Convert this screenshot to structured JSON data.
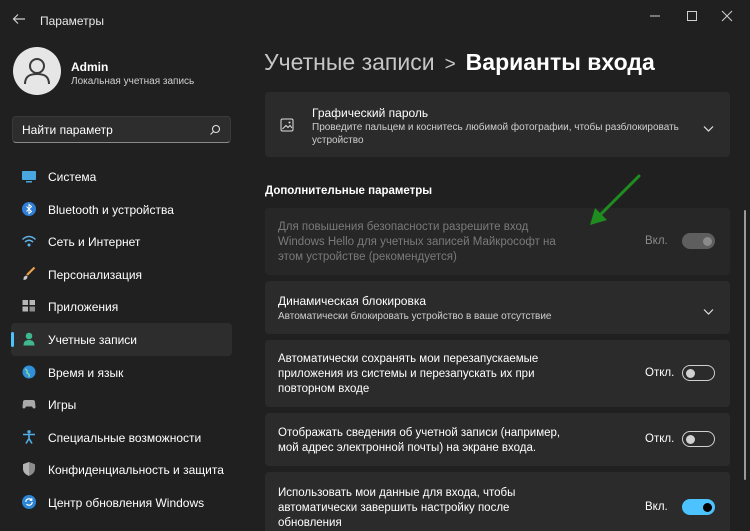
{
  "window": {
    "title": "Параметры"
  },
  "user": {
    "name": "Admin",
    "account_type": "Локальная учетная запись"
  },
  "search": {
    "placeholder": "Найти параметр"
  },
  "sidebar": {
    "items": [
      {
        "label": "Система",
        "icon": "system-icon"
      },
      {
        "label": "Bluetooth и устройства",
        "icon": "bluetooth-icon"
      },
      {
        "label": "Сеть и Интернет",
        "icon": "wifi-icon"
      },
      {
        "label": "Персонализация",
        "icon": "brush-icon"
      },
      {
        "label": "Приложения",
        "icon": "apps-icon"
      },
      {
        "label": "Учетные записи",
        "icon": "person-icon",
        "active": true
      },
      {
        "label": "Время и язык",
        "icon": "globe-icon"
      },
      {
        "label": "Игры",
        "icon": "gamepad-icon"
      },
      {
        "label": "Специальные возможности",
        "icon": "accessibility-icon"
      },
      {
        "label": "Конфиденциальность и защита",
        "icon": "shield-icon"
      },
      {
        "label": "Центр обновления Windows",
        "icon": "update-icon"
      }
    ]
  },
  "breadcrumb": {
    "parent": "Учетные записи",
    "separator": ">",
    "current": "Варианты входа"
  },
  "picture_password": {
    "title": "Графический пароль",
    "description_line1": "Проведите пальцем и коснитесь любимой фотографии, чтобы разблокировать",
    "description_line2": "устройство"
  },
  "additional": {
    "section_title": "Дополнительные параметры",
    "hello_only": {
      "line1": "Для повышения безопасности разрешите вход",
      "line2": "Windows Hello для учетных записей Майкрософт на",
      "line3": "этом устройстве (рекомендуется)",
      "state_label": "Вкл.",
      "state": "on-disabled"
    },
    "dynamic_lock": {
      "title": "Динамическая блокировка",
      "description": "Автоматически блокировать устройство в ваше отсутствие"
    },
    "restart_apps": {
      "line1": "Автоматически сохранять мои перезапускаемые",
      "line2": "приложения из системы и перезапускать их при",
      "line3": "повторном входе",
      "state_label": "Откл.",
      "state": "off"
    },
    "show_account_details": {
      "line1": "Отображать сведения об учетной записи (например,",
      "line2": "мой адрес электронной почты) на экране входа.",
      "state_label": "Откл.",
      "state": "off"
    },
    "use_signin_info": {
      "line1": "Использовать мои данные для входа, чтобы",
      "line2": "автоматически завершить настройку после",
      "line3": "обновления",
      "state_label": "Вкл.",
      "state": "on"
    }
  },
  "colors": {
    "accent": "#4cc2ff",
    "background": "#202020",
    "card": "#2b2b2b",
    "annotation_arrow": "#1e8c1e"
  }
}
